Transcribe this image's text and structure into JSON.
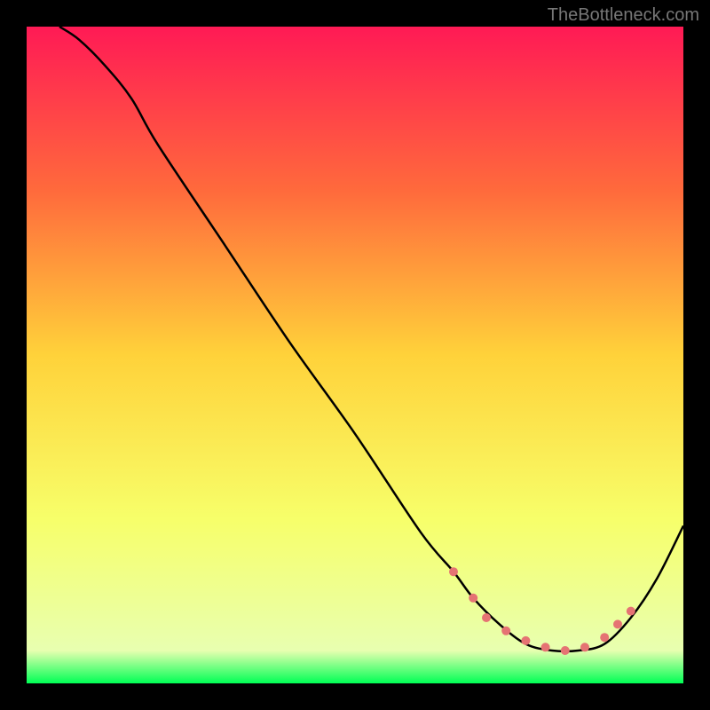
{
  "watermark": "TheBottleneck.com",
  "chart_data": {
    "type": "line",
    "title": "",
    "xlabel": "",
    "ylabel": "",
    "xlim": [
      0,
      100
    ],
    "ylim": [
      0,
      100
    ],
    "grid": false,
    "legend": false,
    "gradient_stops": [
      {
        "offset": 0,
        "color": "#ff1a55"
      },
      {
        "offset": 25,
        "color": "#ff6a3c"
      },
      {
        "offset": 50,
        "color": "#ffd23a"
      },
      {
        "offset": 75,
        "color": "#f7ff6a"
      },
      {
        "offset": 95,
        "color": "#e8ffb0"
      },
      {
        "offset": 100,
        "color": "#00ff55"
      }
    ],
    "series": [
      {
        "name": "bottleneck-curve",
        "color": "#000000",
        "x": [
          5,
          8,
          12,
          16,
          20,
          30,
          40,
          50,
          60,
          65,
          68,
          72,
          76,
          80,
          84,
          88,
          92,
          96,
          100
        ],
        "y": [
          100,
          98,
          94,
          89,
          82,
          67,
          52,
          38,
          23,
          17,
          13,
          9,
          6,
          5,
          5,
          6,
          10,
          16,
          24
        ]
      }
    ],
    "markers": {
      "name": "highlight-dots",
      "color": "#e57373",
      "radius": 5,
      "points": [
        {
          "x": 65,
          "y": 17
        },
        {
          "x": 68,
          "y": 13
        },
        {
          "x": 70,
          "y": 10
        },
        {
          "x": 73,
          "y": 8
        },
        {
          "x": 76,
          "y": 6.5
        },
        {
          "x": 79,
          "y": 5.5
        },
        {
          "x": 82,
          "y": 5
        },
        {
          "x": 85,
          "y": 5.5
        },
        {
          "x": 88,
          "y": 7
        },
        {
          "x": 90,
          "y": 9
        },
        {
          "x": 92,
          "y": 11
        }
      ]
    }
  }
}
